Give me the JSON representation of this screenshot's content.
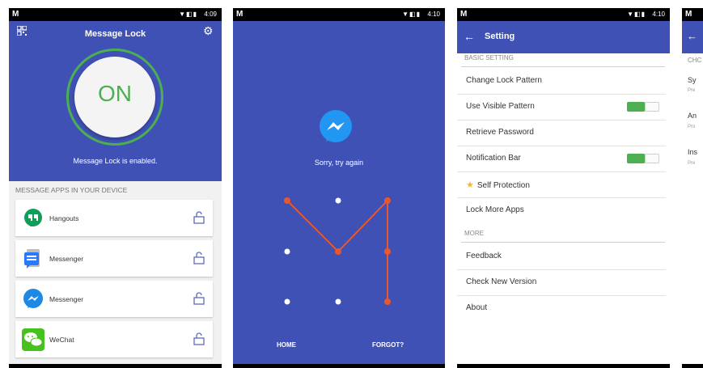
{
  "status_bar": {
    "screen1_time": "4:09",
    "screen2_time": "4:10",
    "screen3_time": "4:10"
  },
  "screen1": {
    "title": "Message Lock",
    "toggle_state": "ON",
    "status_text": "Message Lock is enabled.",
    "section_header": "MESSAGE APPS IN YOUR DEVICE",
    "apps": [
      {
        "name": "Hangouts",
        "icon": "hangouts-icon"
      },
      {
        "name": "Messenger",
        "icon": "messenger-blue-icon"
      },
      {
        "name": "Messenger",
        "icon": "facebook-messenger-icon"
      },
      {
        "name": "WeChat",
        "icon": "wechat-icon"
      }
    ],
    "colors": {
      "primary": "#3f51b5",
      "accent": "#4caf50"
    }
  },
  "screen2": {
    "message": "Sorry, try again",
    "home_label": "HOME",
    "forgot_label": "FORGOT?",
    "pattern_color": "#e8582b"
  },
  "screen3": {
    "title": "Setting",
    "basic_header": "BASIC SETTING",
    "more_header": "MORE",
    "items": {
      "change_lock": "Change Lock Pattern",
      "visible_pattern": "Use Visible Pattern",
      "retrieve_password": "Retrieve Password",
      "notification_bar": "Notification Bar",
      "self_protection": "Self Protection",
      "lock_more": "Lock More Apps",
      "feedback": "Feedback",
      "check_version": "Check New Version",
      "about": "About"
    }
  },
  "screen4": {
    "header": "CHC",
    "items": [
      {
        "title": "Sy",
        "sub": "Pre"
      },
      {
        "title": "An",
        "sub": "Pro"
      },
      {
        "title": "Ins",
        "sub": "Pre"
      }
    ]
  }
}
